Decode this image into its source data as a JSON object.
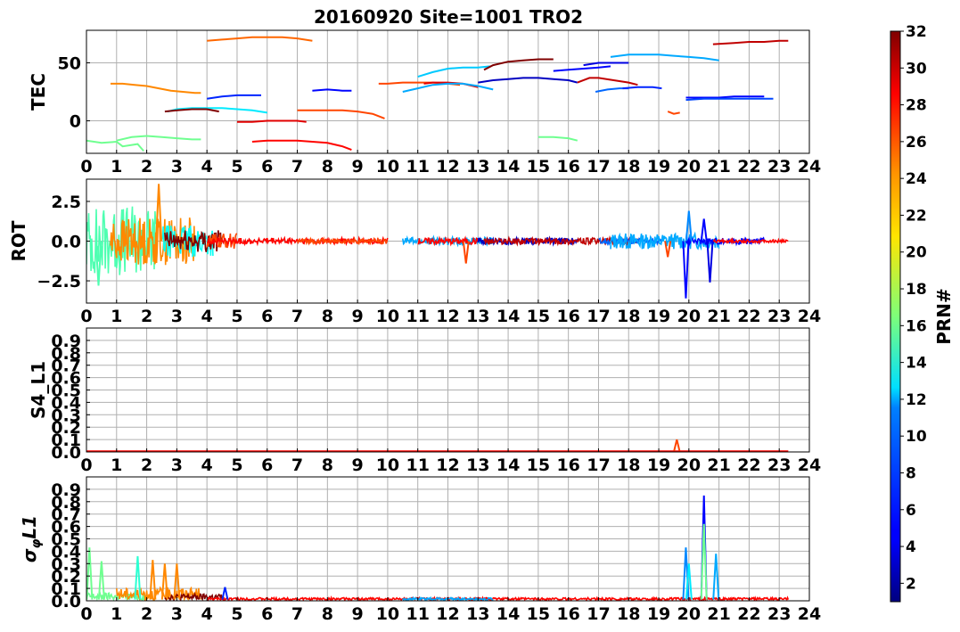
{
  "chart_data": {
    "type": "line",
    "title": "20160920 Site=1001 TRO2",
    "x_ticks": [
      "0",
      "1",
      "2",
      "3",
      "4",
      "5",
      "6",
      "7",
      "8",
      "9",
      "10",
      "11",
      "12",
      "13",
      "14",
      "15",
      "16",
      "17",
      "18",
      "19",
      "20",
      "21",
      "22",
      "23",
      "24"
    ],
    "xlim": [
      0,
      24
    ],
    "grid": true,
    "colorbar": {
      "label": "PRN#",
      "range": [
        1,
        32
      ],
      "ticks": [
        "2",
        "4",
        "6",
        "8",
        "10",
        "12",
        "14",
        "16",
        "18",
        "20",
        "22",
        "24",
        "26",
        "28",
        "30",
        "32"
      ],
      "colormap": "jet"
    },
    "panels": [
      {
        "ylabel": "TEC",
        "ylim": [
          -28,
          78
        ],
        "yticks": [
          "0",
          "50"
        ],
        "segments": [
          {
            "prn": 16,
            "x": [
              0.0,
              0.5,
              1.0,
              1.2,
              1.7,
              1.9
            ],
            "y": [
              -17,
              -19,
              -18,
              -22,
              -20,
              -26
            ]
          },
          {
            "prn": 16,
            "x": [
              1.0,
              1.5,
              2.0,
              2.5,
              3.0,
              3.5,
              3.8
            ],
            "y": [
              -17,
              -14,
              -13,
              -14,
              -15,
              -16,
              -16
            ]
          },
          {
            "prn": 24,
            "x": [
              0.8,
              1.2,
              1.6,
              2.0,
              2.4,
              2.8,
              3.2,
              3.6,
              3.8
            ],
            "y": [
              32,
              32,
              31,
              30,
              28,
              26,
              25,
              24,
              24
            ]
          },
          {
            "prn": 12,
            "x": [
              2.7,
              3.0,
              3.5,
              4.0,
              4.5,
              5.0,
              5.5,
              6.0
            ],
            "y": [
              8,
              10,
              11,
              11,
              11,
              10,
              9,
              7
            ]
          },
          {
            "prn": 32,
            "x": [
              2.6,
              3.0,
              3.5,
              4.0,
              4.4
            ],
            "y": [
              8,
              9,
              10,
              10,
              8
            ]
          },
          {
            "prn": 25,
            "x": [
              4.0,
              4.5,
              5.0,
              5.5,
              6.0,
              6.5,
              7.0,
              7.5
            ],
            "y": [
              69,
              70,
              71,
              72,
              72,
              72,
              71,
              69
            ]
          },
          {
            "prn": 6,
            "x": [
              4.0,
              4.5,
              5.0,
              5.5,
              5.8
            ],
            "y": [
              19,
              21,
              22,
              22,
              22
            ]
          },
          {
            "prn": 29,
            "x": [
              5.0,
              5.5,
              6.0,
              6.5,
              7.0,
              7.3
            ],
            "y": [
              -1,
              -1,
              0,
              0,
              0,
              -1
            ]
          },
          {
            "prn": 28,
            "x": [
              5.5,
              6.0,
              6.5,
              7.0,
              7.5,
              8.0,
              8.5,
              8.8
            ],
            "y": [
              -18,
              -17,
              -17,
              -17,
              -18,
              -19,
              -22,
              -25
            ]
          },
          {
            "prn": 26,
            "x": [
              7.0,
              7.5,
              8.0,
              8.5,
              9.0,
              9.5,
              9.9
            ],
            "y": [
              9,
              9,
              9,
              9,
              8,
              6,
              2
            ]
          },
          {
            "prn": 5,
            "x": [
              7.5,
              8.0,
              8.5,
              8.8
            ],
            "y": [
              26,
              27,
              26,
              26
            ]
          },
          {
            "prn": 26,
            "x": [
              9.7,
              10.0,
              10.5,
              11.0,
              11.5,
              12.0,
              12.4
            ],
            "y": [
              32,
              32,
              33,
              33,
              33,
              32,
              31
            ]
          },
          {
            "prn": 29,
            "x": [
              11.2,
              11.5,
              12.0,
              12.5,
              13.0
            ],
            "y": [
              32,
              33,
              33,
              32,
              29
            ]
          },
          {
            "prn": 10,
            "x": [
              10.5,
              11.0,
              11.5,
              12.0,
              12.5,
              13.0,
              13.5
            ],
            "y": [
              25,
              28,
              31,
              32,
              32,
              30,
              27
            ]
          },
          {
            "prn": 11,
            "x": [
              11.0,
              11.5,
              12.0,
              12.5,
              13.0,
              13.4
            ],
            "y": [
              38,
              42,
              45,
              46,
              46,
              47
            ]
          },
          {
            "prn": 3,
            "x": [
              13.0,
              13.5,
              14.0,
              14.5,
              15.0,
              15.5,
              16.0,
              16.3
            ],
            "y": [
              33,
              35,
              36,
              37,
              37,
              36,
              35,
              33
            ]
          },
          {
            "prn": 32,
            "x": [
              13.2,
              13.5,
              14.0,
              14.5,
              15.0,
              15.5
            ],
            "y": [
              44,
              48,
              51,
              52,
              53,
              53
            ]
          },
          {
            "prn": 16,
            "x": [
              15.0,
              15.5,
              16.0,
              16.3
            ],
            "y": [
              -14,
              -14,
              -15,
              -17
            ]
          },
          {
            "prn": 5,
            "x": [
              15.5,
              16.0,
              16.5,
              17.0,
              17.4
            ],
            "y": [
              43,
              44,
              45,
              46,
              47
            ]
          },
          {
            "prn": 30,
            "x": [
              16.3,
              16.7,
              17.0,
              17.5,
              18.0,
              18.3
            ],
            "y": [
              33,
              37,
              37,
              35,
              33,
              31
            ]
          },
          {
            "prn": 4,
            "x": [
              16.5,
              17.0,
              17.5,
              18.0
            ],
            "y": [
              48,
              50,
              50,
              50
            ]
          },
          {
            "prn": 8,
            "x": [
              16.9,
              17.3,
              17.7,
              18.0
            ],
            "y": [
              25,
              27,
              28,
              28
            ]
          },
          {
            "prn": 6,
            "x": [
              17.8,
              18.3,
              18.8,
              19.1
            ],
            "y": [
              28,
              29,
              29,
              28
            ]
          },
          {
            "prn": 10,
            "x": [
              17.4,
              18.0,
              18.5,
              19.0,
              19.5,
              20.0,
              20.5,
              21.0
            ],
            "y": [
              55,
              57,
              57,
              57,
              56,
              55,
              54,
              52
            ]
          },
          {
            "prn": 26,
            "x": [
              19.3,
              19.5,
              19.7
            ],
            "y": [
              8,
              6,
              7
            ]
          },
          {
            "prn": 5,
            "x": [
              19.9,
              20.5,
              21.0,
              21.5,
              22.0,
              22.5
            ],
            "y": [
              20,
              20,
              20,
              21,
              21,
              21
            ]
          },
          {
            "prn": 7,
            "x": [
              19.9,
              20.5,
              21.0,
              21.5,
              22.0,
              22.8
            ],
            "y": [
              18,
              19,
              19,
              19,
              19,
              19
            ]
          },
          {
            "prn": 30,
            "x": [
              20.8,
              21.5,
              22.0,
              22.5,
              23.0,
              23.3
            ],
            "y": [
              66,
              67,
              68,
              68,
              69,
              69
            ]
          }
        ]
      },
      {
        "ylabel": "ROT",
        "ylim": [
          -3.9,
          3.9
        ],
        "yticks": [
          "2.5",
          "0.0",
          "−2.5"
        ],
        "bands": [
          {
            "prn": 15,
            "x0": 0.0,
            "x1": 2.3,
            "amp": 2.2
          },
          {
            "prn": 24,
            "x0": 0.8,
            "x1": 3.6,
            "amp": 1.5
          },
          {
            "prn": 13,
            "x0": 2.5,
            "x1": 4.2,
            "amp": 1.0
          },
          {
            "prn": 32,
            "x0": 2.6,
            "x1": 4.5,
            "amp": 0.7
          },
          {
            "prn": 26,
            "x0": 4.0,
            "x1": 5.0,
            "amp": 0.5
          },
          {
            "prn": 28,
            "x0": 4.0,
            "x1": 10.0,
            "amp": 0.2
          },
          {
            "prn": 26,
            "x0": 7.0,
            "x1": 10.0,
            "amp": 0.15
          },
          {
            "prn": 10,
            "x0": 10.5,
            "x1": 13.5,
            "amp": 0.25
          },
          {
            "prn": 28,
            "x0": 11.0,
            "x1": 13.0,
            "amp": 0.2
          },
          {
            "prn": 3,
            "x0": 13.0,
            "x1": 16.3,
            "amp": 0.2
          },
          {
            "prn": 30,
            "x0": 13.2,
            "x1": 18.3,
            "amp": 0.2
          },
          {
            "prn": 8,
            "x0": 17.0,
            "x1": 19.1,
            "amp": 0.2
          },
          {
            "prn": 10,
            "x0": 17.4,
            "x1": 21.0,
            "amp": 0.5
          },
          {
            "prn": 5,
            "x0": 19.9,
            "x1": 22.5,
            "amp": 0.2
          },
          {
            "prn": 28,
            "x0": 20.8,
            "x1": 23.3,
            "amp": 0.1
          }
        ],
        "spikes": [
          {
            "prn": 24,
            "x": 2.4,
            "y": 3.6
          },
          {
            "prn": 26,
            "x": 12.6,
            "y": -1.4
          },
          {
            "prn": 26,
            "x": 19.3,
            "y": -1.0
          },
          {
            "prn": 5,
            "x": 19.9,
            "y": -3.6
          },
          {
            "prn": 5,
            "x": 20.5,
            "y": 1.4
          },
          {
            "prn": 4,
            "x": 20.7,
            "y": -2.6
          },
          {
            "prn": 9,
            "x": 20.0,
            "y": 1.9
          },
          {
            "prn": 15,
            "x": 0.4,
            "y": -2.8
          }
        ]
      },
      {
        "ylabel": "S4_L1",
        "ylim": [
          0,
          1.0
        ],
        "yticks": [
          "0.0",
          "0.1",
          "0.2",
          "0.3",
          "0.4",
          "0.5",
          "0.6",
          "0.7",
          "0.8",
          "0.9"
        ],
        "baseline": {
          "prn": 28,
          "x0": 0.0,
          "x1": 23.3,
          "y": 0.005
        },
        "spikes": [
          {
            "prn": 26,
            "x": 19.6,
            "y": 0.1
          }
        ]
      },
      {
        "ylabel": "σ_φL1",
        "ylim": [
          0,
          1.0
        ],
        "yticks": [
          "0.0",
          "0.1",
          "0.2",
          "0.3",
          "0.4",
          "0.5",
          "0.6",
          "0.7",
          "0.8",
          "0.9"
        ],
        "bands": [
          {
            "prn": 16,
            "x0": 0.0,
            "x1": 2.0,
            "amp": 0.06
          },
          {
            "prn": 24,
            "x0": 1.0,
            "x1": 3.8,
            "amp": 0.1
          },
          {
            "prn": 32,
            "x0": 2.6,
            "x1": 4.5,
            "amp": 0.05
          },
          {
            "prn": 28,
            "x0": 4.0,
            "x1": 23.3,
            "amp": 0.02
          },
          {
            "prn": 10,
            "x0": 10.5,
            "x1": 13.5,
            "amp": 0.02
          }
        ],
        "spikes": [
          {
            "prn": 16,
            "x": 0.1,
            "y": 0.43
          },
          {
            "prn": 16,
            "x": 0.5,
            "y": 0.32
          },
          {
            "prn": 14,
            "x": 1.7,
            "y": 0.36
          },
          {
            "prn": 24,
            "x": 2.2,
            "y": 0.33
          },
          {
            "prn": 24,
            "x": 2.6,
            "y": 0.3
          },
          {
            "prn": 24,
            "x": 3.0,
            "y": 0.3
          },
          {
            "prn": 6,
            "x": 4.6,
            "y": 0.11
          },
          {
            "prn": 9,
            "x": 19.9,
            "y": 0.43
          },
          {
            "prn": 12,
            "x": 20.0,
            "y": 0.3
          },
          {
            "prn": 5,
            "x": 20.5,
            "y": 0.85
          },
          {
            "prn": 16,
            "x": 20.5,
            "y": 0.62
          },
          {
            "prn": 10,
            "x": 20.9,
            "y": 0.38
          }
        ]
      }
    ]
  }
}
